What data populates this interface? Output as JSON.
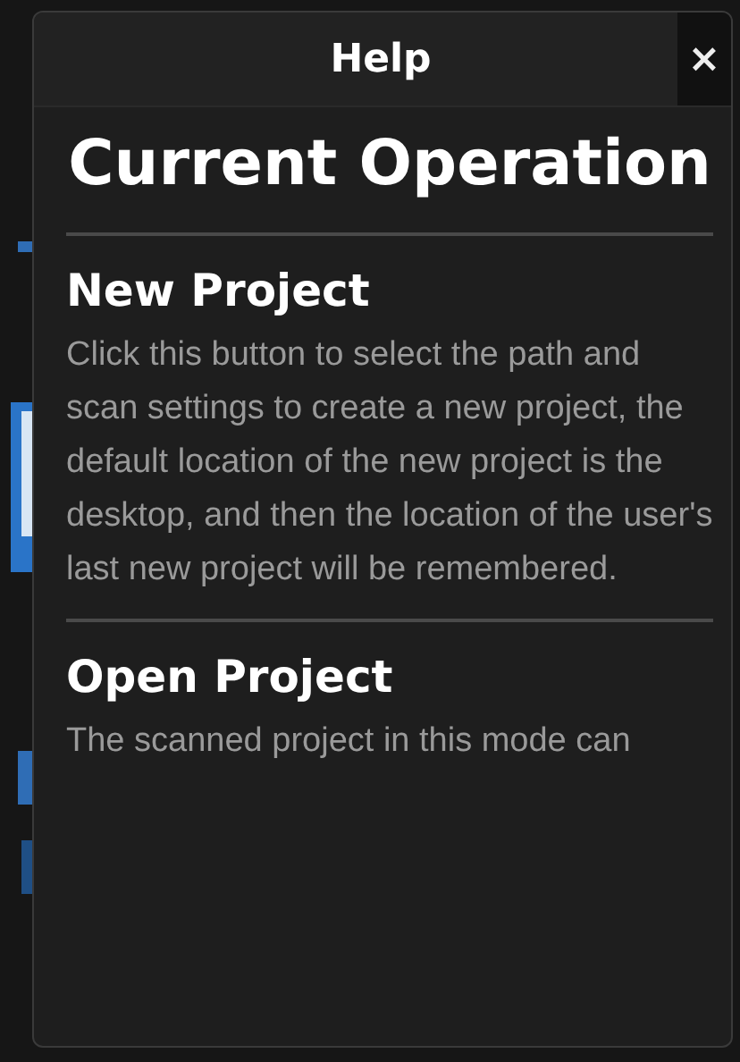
{
  "window": {
    "title": "Help",
    "close": "×"
  },
  "heading": "Current Operation",
  "sections": [
    {
      "title": "New Project",
      "text": "Click this button to select the path and scan settings to create a new project, the default location of the new project is the desktop, and then the location of the user's last new project will be remembered."
    },
    {
      "title": "Open Project",
      "text": "The scanned project in this mode can"
    }
  ]
}
